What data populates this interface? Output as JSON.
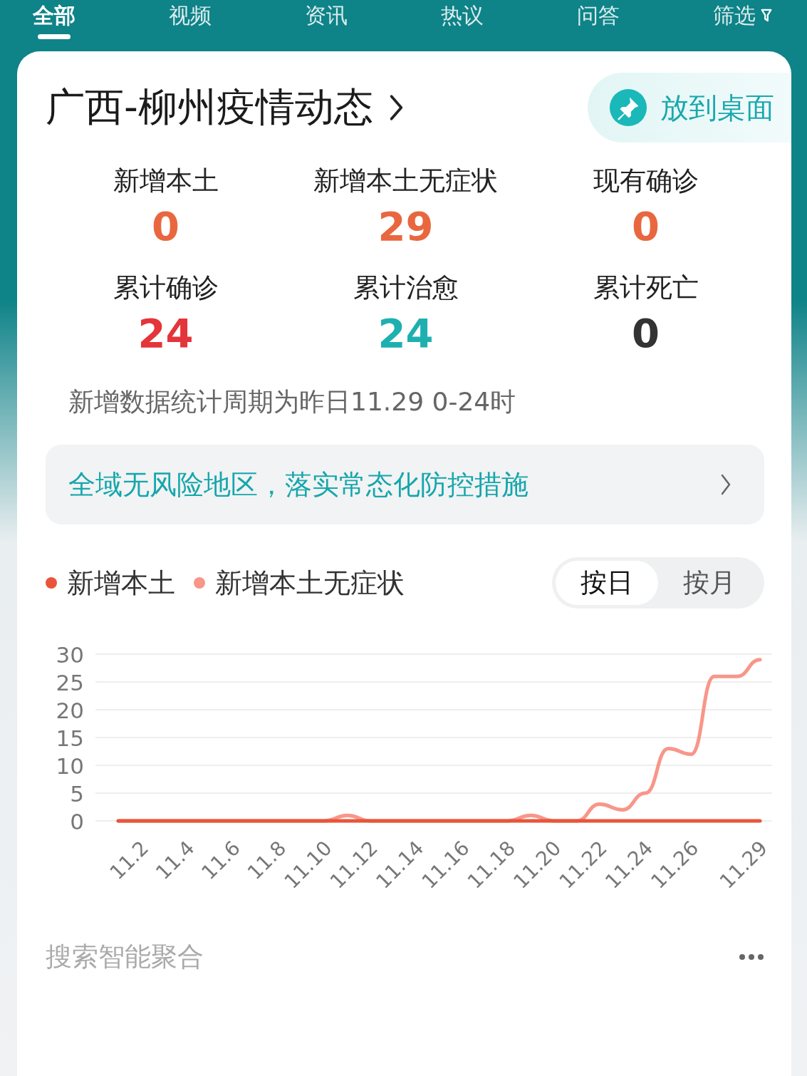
{
  "tabs": [
    {
      "label": "全部",
      "selected": true
    },
    {
      "label": "视频",
      "selected": false
    },
    {
      "label": "资讯",
      "selected": false
    },
    {
      "label": "热议",
      "selected": false
    },
    {
      "label": "问答",
      "selected": false
    },
    {
      "label": "筛选",
      "selected": false,
      "kind": "filter"
    }
  ],
  "card": {
    "title": "广西-柳州疫情动态",
    "pin_button": "放到桌面",
    "stats": [
      {
        "label": "新增本土",
        "value": "0",
        "color": "#e9673f"
      },
      {
        "label": "新增本土无症状",
        "value": "29",
        "color": "#e9673f"
      },
      {
        "label": "现有确诊",
        "value": "0",
        "color": "#e9673f"
      },
      {
        "label": "累计确诊",
        "value": "24",
        "color": "#e3353a"
      },
      {
        "label": "累计治愈",
        "value": "24",
        "color": "#1eb0b0"
      },
      {
        "label": "累计死亡",
        "value": "0",
        "color": "#333333"
      }
    ],
    "note": "新增数据统计周期为昨日11.29 0-24时",
    "banner": "全域无风险地区，落实常态化防控措施",
    "range_toggle": [
      {
        "label": "按日",
        "selected": true
      },
      {
        "label": "按月",
        "selected": false
      }
    ],
    "chart_data": {
      "type": "line",
      "categories": [
        null,
        "11.2",
        null,
        "11.4",
        null,
        "11.6",
        null,
        "11.8",
        null,
        "11.10",
        null,
        "11.12",
        null,
        "11.14",
        null,
        "11.16",
        null,
        "11.18",
        null,
        "11.20",
        null,
        "11.22",
        null,
        "11.24",
        null,
        "11.26",
        null,
        null,
        "11.29"
      ],
      "yticks": [
        0,
        5,
        10,
        15,
        20,
        25,
        30
      ],
      "ylim": [
        0,
        30
      ],
      "grid": true,
      "series": [
        {
          "name": "新增本土",
          "color": "#e8553a",
          "values": [
            0,
            0,
            0,
            0,
            0,
            0,
            0,
            0,
            0,
            0,
            0,
            0,
            0,
            0,
            0,
            0,
            0,
            0,
            0,
            0,
            0,
            0,
            0,
            0,
            0,
            0,
            0,
            0,
            0
          ]
        },
        {
          "name": "新增本土无症状",
          "color": "#f8968a",
          "values": [
            0,
            0,
            0,
            0,
            0,
            0,
            0,
            0,
            0,
            0,
            1,
            0,
            0,
            0,
            0,
            0,
            0,
            0,
            1,
            0,
            0,
            3,
            2,
            5,
            13,
            12,
            26,
            26,
            29
          ]
        }
      ]
    },
    "footer": "搜索智能聚合"
  }
}
